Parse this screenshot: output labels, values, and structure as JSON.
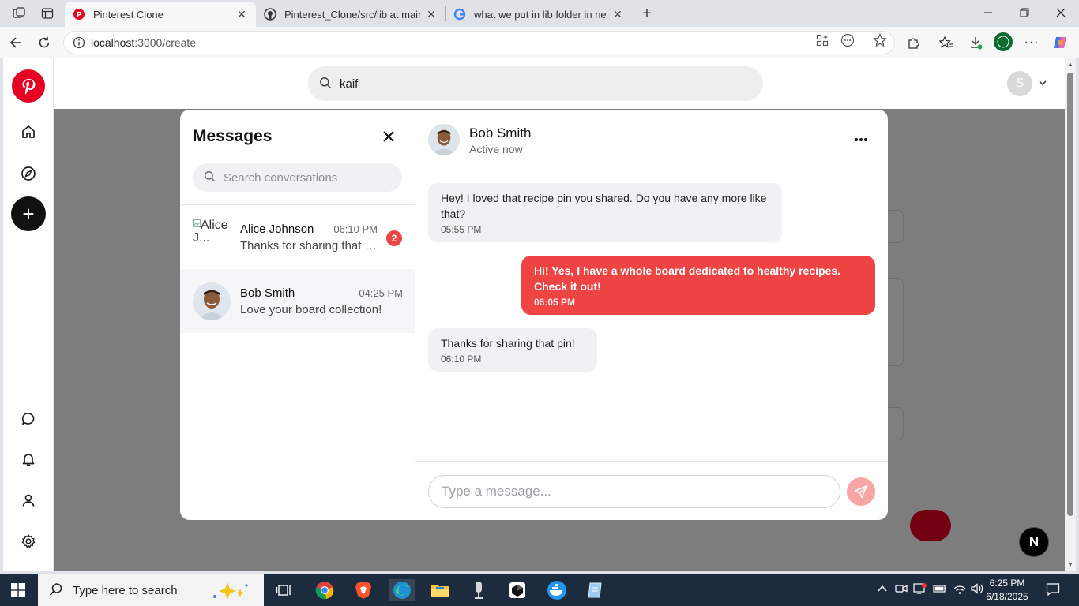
{
  "browser": {
    "tabs": [
      {
        "title": "Pinterest Clone",
        "active": true
      },
      {
        "title": "Pinterest_Clone/src/lib at main · M",
        "active": false
      },
      {
        "title": "what we put in lib folder in nextjs",
        "active": false
      }
    ],
    "url_host": "localhost",
    "url_rest": ":3000/create"
  },
  "page": {
    "search_value": "kaif",
    "user_initial": "S"
  },
  "messages": {
    "title": "Messages",
    "search_placeholder": "Search conversations",
    "conversations": [
      {
        "name": "Alice Johnson",
        "avatar_alt": "Alice J...",
        "time": "06:10 PM",
        "preview": "Thanks for sharing that pin!",
        "unread": "2"
      },
      {
        "name": "Bob Smith",
        "time": "04:25 PM",
        "preview": "Love your board collection!"
      }
    ],
    "chat": {
      "name": "Bob Smith",
      "status": "Active now",
      "messages": [
        {
          "text": "Hey! I loved that recipe pin you shared. Do you have any more like that?",
          "time": "05:55 PM",
          "direction": "in"
        },
        {
          "text": "Hi! Yes, I have a whole board dedicated to healthy recipes. Check it out!",
          "time": "06:05 PM",
          "direction": "out"
        },
        {
          "text": "Thanks for sharing that pin!",
          "time": "06:10 PM",
          "direction": "in"
        }
      ],
      "input_placeholder": "Type a message..."
    }
  },
  "next_badge": "N",
  "taskbar": {
    "search_placeholder": "Type here to search",
    "time": "6:25 PM",
    "date": "6/18/2025"
  },
  "colors": {
    "accent_red": "#ef4444",
    "pinterest_red": "#e60023",
    "send_button": "#f8a5a5"
  }
}
